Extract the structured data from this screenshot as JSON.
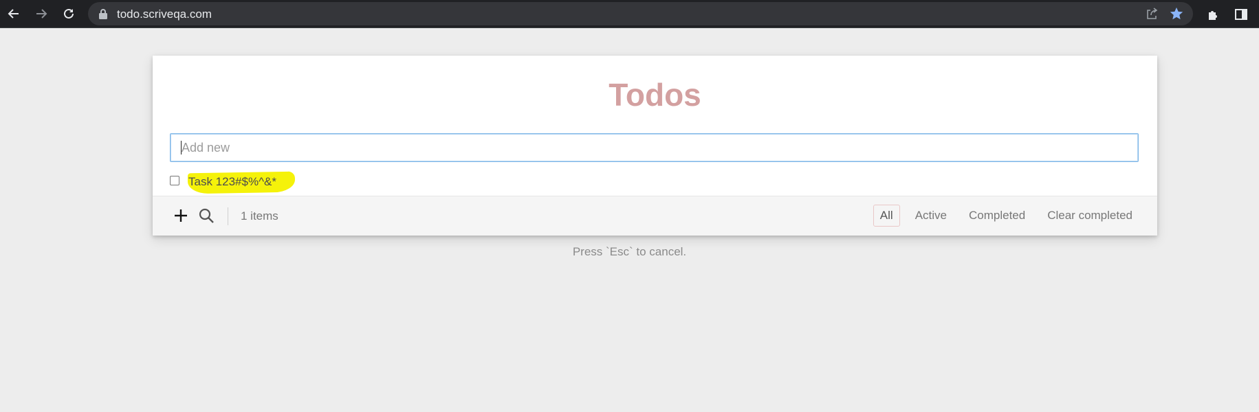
{
  "browser": {
    "url": "todo.scriveqa.com",
    "icons": [
      "back-arrow-icon",
      "forward-arrow-icon",
      "reload-icon",
      "lock-icon",
      "share-icon",
      "star-icon",
      "extensions-icon",
      "side-panel-icon"
    ],
    "star_color": "#8ab4f8"
  },
  "app": {
    "title": "Todos",
    "title_color": "#d3a0a0",
    "new_todo": {
      "placeholder": "Add new",
      "value": ""
    },
    "todos": [
      {
        "label": "Task 123#$%^&*",
        "completed": false,
        "highlighted": true
      }
    ],
    "footer": {
      "count": "1 items",
      "filters": [
        {
          "label": "All",
          "selected": true
        },
        {
          "label": "Active",
          "selected": false
        },
        {
          "label": "Completed",
          "selected": false
        },
        {
          "label": "Clear completed",
          "selected": false
        }
      ]
    },
    "hint": "Press `Esc` to cancel."
  }
}
